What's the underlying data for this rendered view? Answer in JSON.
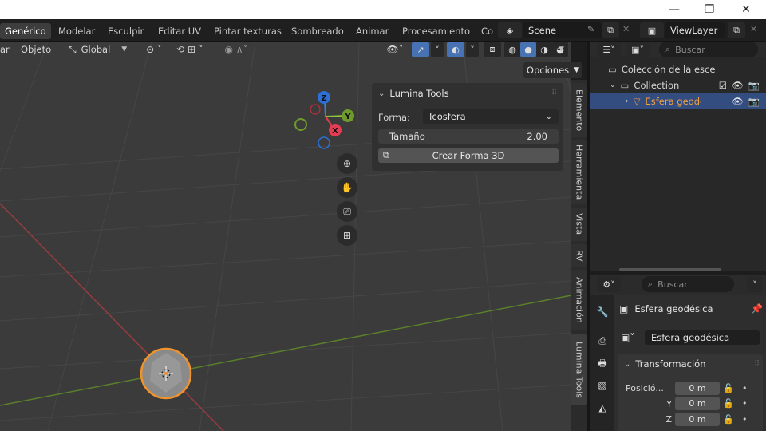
{
  "window": {
    "minimize": "—",
    "maximize": "❐",
    "close": "✕"
  },
  "workspaces": [
    "Genérico",
    "Modelar",
    "Esculpir",
    "Editar UV",
    "Pintar texturas",
    "Sombreado",
    "Animar",
    "Procesamiento",
    "Co"
  ],
  "scene": {
    "label": "Scene"
  },
  "view_layer": {
    "label": "ViewLayer"
  },
  "viewport_header": {
    "mode_cut": "ar",
    "object_menu": "Objeto",
    "orientation": "Global",
    "options_label": "Opciones"
  },
  "gizmo": {
    "z": "Z",
    "y": "Y",
    "x": "X"
  },
  "lumina_panel": {
    "title": "Lumina Tools",
    "shape_label": "Forma:",
    "shape_value": "Icosfera",
    "size_label": "Tamaño",
    "size_value": "2.00",
    "create_button": "Crear Forma 3D"
  },
  "side_tabs": [
    "Elemento",
    "Herramienta",
    "Vista",
    "RV",
    "Animación",
    "Lumina Tools"
  ],
  "outliner": {
    "search_placeholder": "Buscar",
    "scene_collection": "Colección de la esce",
    "collection": "Collection",
    "object": "Esfera geode"
  },
  "properties": {
    "search_placeholder": "Buscar",
    "object_name": "Esfera geodésica",
    "object_field": "Esfera geodésica",
    "transform_title": "Transformación",
    "position_label": "Posició...",
    "y_label": "Y",
    "z_label": "Z",
    "x_value": "0 m",
    "y_value": "0 m",
    "z_value": "0 m"
  },
  "colors": {
    "accent": "#4772b3",
    "selected_row": "#334d80",
    "x_axis": "#b8373a",
    "y_axis": "#6f9a2c",
    "object_outline": "#f0932b"
  }
}
